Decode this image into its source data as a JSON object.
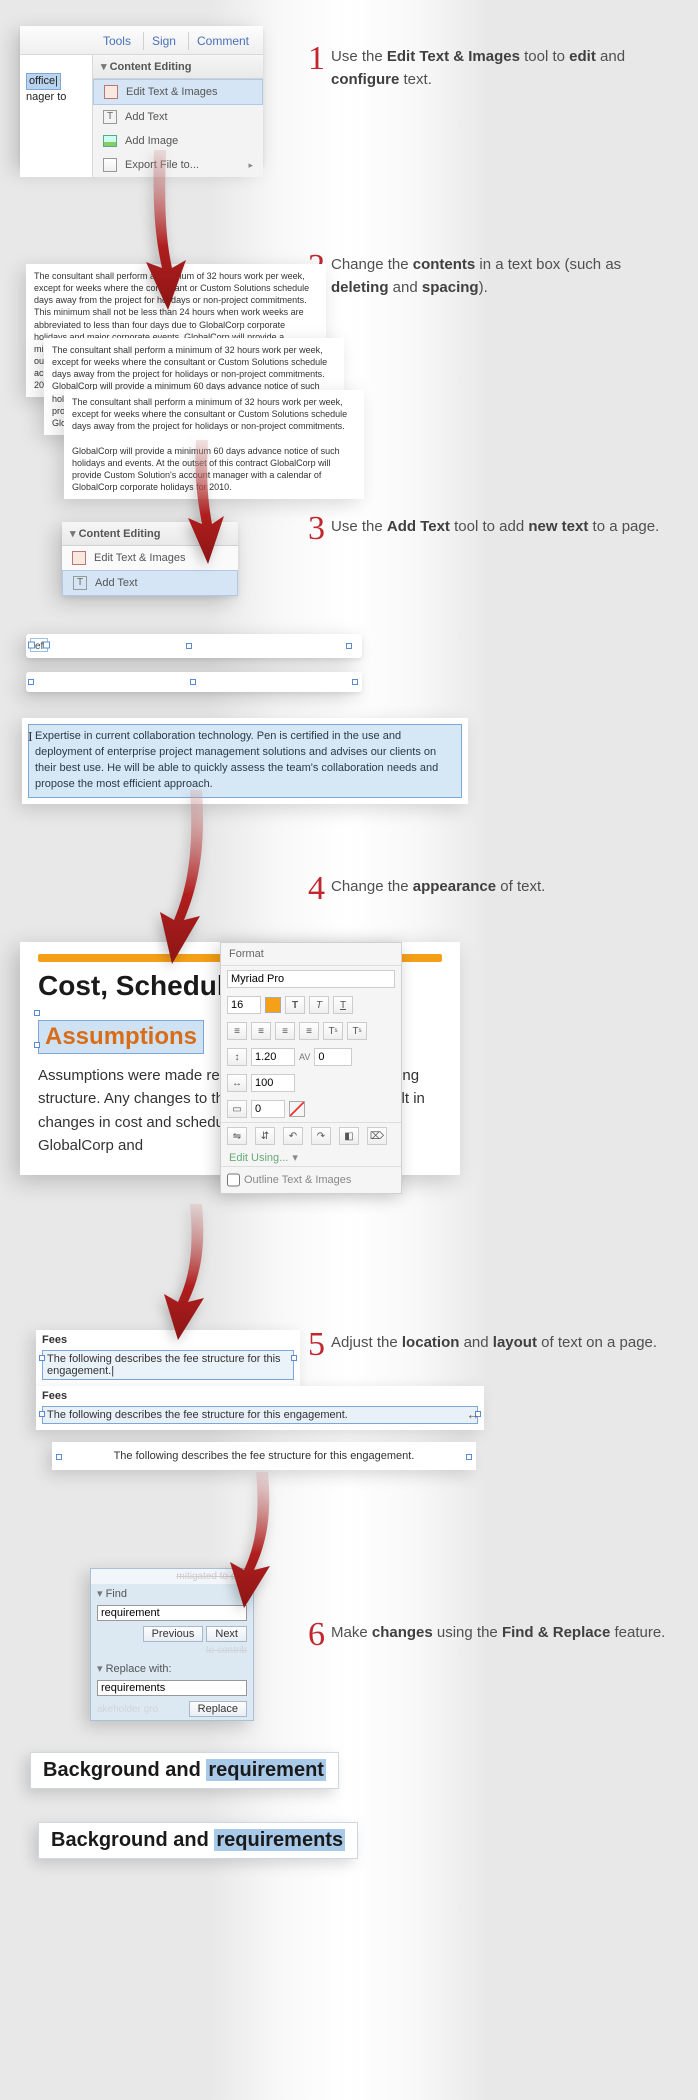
{
  "steps": [
    {
      "num": "1",
      "pre": "Use the ",
      "b1": "Edit Text & Images",
      "mid": " tool to ",
      "b2": "edit",
      "mid2": " and ",
      "b3": "configure",
      "post": " text."
    },
    {
      "num": "2",
      "pre": "Change the ",
      "b1": "contents",
      "mid": " in a text box (such as ",
      "b2": "deleting",
      "mid2": " and ",
      "b3": "spacing",
      "post": ")."
    },
    {
      "num": "3",
      "pre": "Use the ",
      "b1": "Add Text",
      "mid": " tool to add ",
      "b2": "new text",
      "post": " to a page."
    },
    {
      "num": "4",
      "pre": "Change the ",
      "b1": "appearance",
      "post": " of text."
    },
    {
      "num": "5",
      "pre": "Adjust the ",
      "b1": "location",
      "mid": " and ",
      "b2": "layout",
      "post": " of text on a page."
    },
    {
      "num": "6",
      "pre": "Make ",
      "b1": "changes",
      "mid": " using the ",
      "b2": "Find & Replace",
      "post": " feature."
    }
  ],
  "menu": {
    "tools": "Tools",
    "sign": "Sign",
    "comment": "Comment"
  },
  "ce": {
    "title": "Content Editing",
    "items": [
      "Edit Text & Images",
      "Add Text",
      "Add Image",
      "Export File to..."
    ]
  },
  "doc_snip": {
    "word": "office",
    "tail": "nager to"
  },
  "para1": "The consultant shall perform a minimum of 32 hours work per week, except for weeks where the consultant or Custom Solutions schedule days away from the project for holidays or non-project commitments. This minimum shall not be less than 24 hours when work weeks are abbreviated to less than four days due to GlobalCorp corporate holidays and major corporate events. GlobalCorp will provide a minimum 60 days advance notice of such holidays and events. At the outset of this contract GlobalCorp will provide Custom Solution's account manager with a calendar of GlobalCorp corporate holidays for 2010.",
  "para2": "The consultant shall perform a minimum of 32 hours work per week, except for weeks where the consultant or Custom Solutions schedule days away from the project for holidays or non-project commitments. GlobalCorp will provide a minimum 60 days advance notice of such holidays and events. At the outset of this contract GlobalCorp will provide Custom Solution's account manager with a calendar of GlobalCorp corporate holidays for 2010.",
  "para3": "The consultant shall perform a minimum of 32 hours work per week, except for weeks where the consultant or Custom Solutions schedule days away from the project for holidays or non-project commitments.\n\nGlobalCorp will provide a minimum 60 days advance notice of such holidays and events. At the outset of this contract GlobalCorp will provide Custom Solution's account manager with a calendar of GlobalCorp corporate holidays for 2010.",
  "addtext_snip": "ef",
  "bigtext": "Expertise in current collaboration technology.  Pen is certified in the use and deployment of enterprise project management solutions and advises our clients on their best use. He will be able to quickly assess the team's collaboration needs and propose the most efficient approach.",
  "doc4": {
    "h1": "Cost, Schedule",
    "h2": "Assumptions",
    "body": "Assumptions were made regarding the associated pricing structure. Any changes to the proposed scope will result in changes in cost and schedule negotiated between GlobalCorp and"
  },
  "format": {
    "title": "Format",
    "font": "Myriad Pro",
    "size": "16",
    "line": "1.20",
    "av": "0",
    "t100": "100",
    "stroke": "0",
    "editusing": "Edit Using...",
    "outline": "Outline Text & Images"
  },
  "fees": {
    "title": "Fees",
    "line": "The following describes the fee structure for this engagement."
  },
  "find": {
    "ghost": "mitigated to con",
    "findlab": "Find",
    "findval": "requirement",
    "prev": "Previous",
    "next": "Next",
    "replab": "Replace with:",
    "repval": "requirements",
    "ghost2": "akeholder gro",
    "replace": "Replace",
    "ghost3": "to contrib"
  },
  "results": {
    "pre": "Background and ",
    "m1": "requirement",
    "m2": "requirements"
  }
}
